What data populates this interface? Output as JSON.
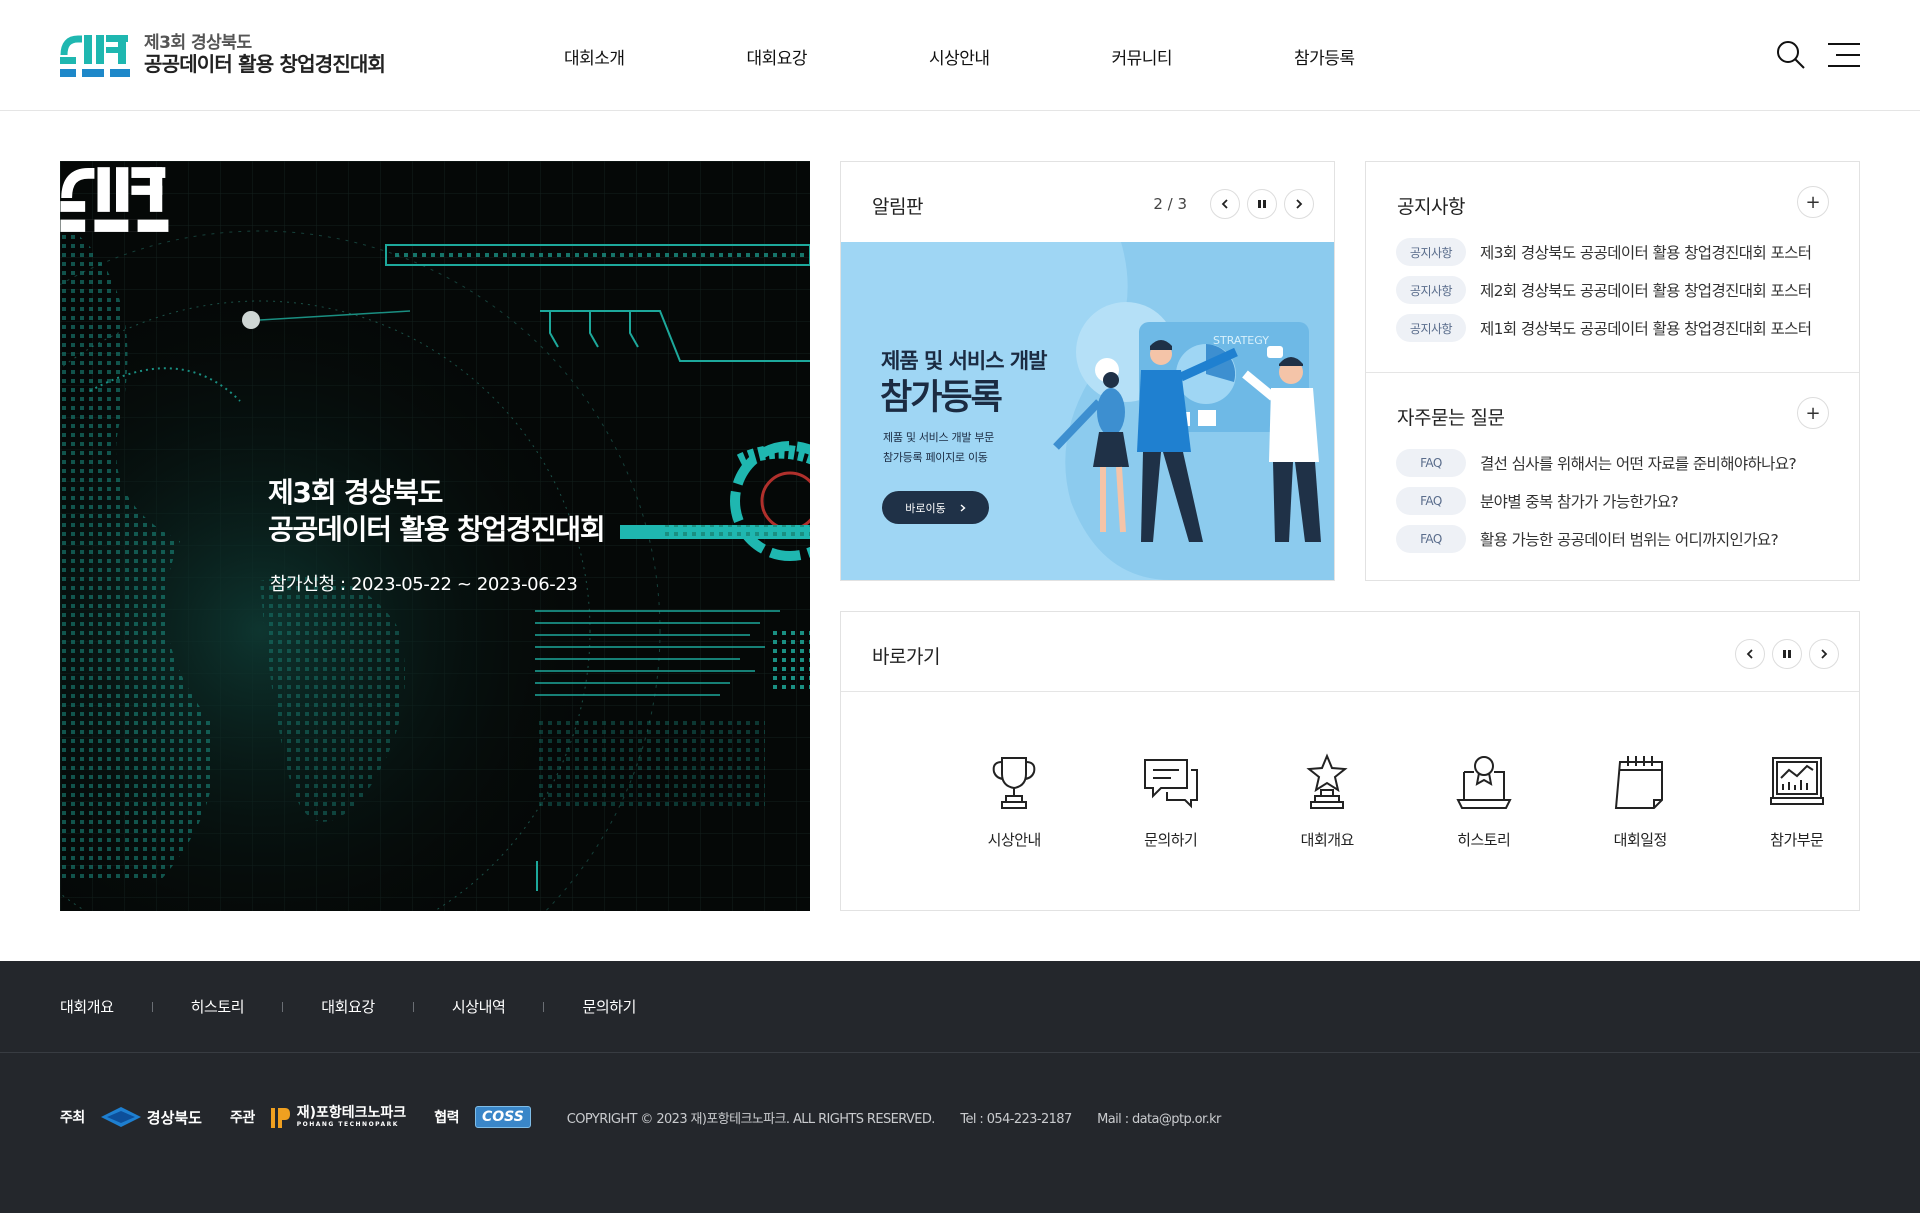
{
  "header": {
    "logo_small": "제3회 경상북도",
    "logo_big": "공공데이터 활용 창업경진대회",
    "nav": [
      "대회소개",
      "대회요강",
      "시상안내",
      "커뮤니티",
      "참가등록"
    ]
  },
  "hero": {
    "title_line1": "제3회 경상북도",
    "title_line2": "공공데이터 활용 창업경진대회",
    "date": "참가신청 : 2023-05-22 ~ 2023-06-23"
  },
  "board": {
    "title": "알림판",
    "page_current": "2",
    "page_sep": " / ",
    "page_total": "3",
    "banner": {
      "line1": "제품 및 서비스 개발",
      "line2": "참가등록",
      "desc1": "제품 및 서비스 개발 부문",
      "desc2": "참가등록 페이지로 이동",
      "button": "바로이동",
      "chart_word": "STRATEGY"
    }
  },
  "notice": {
    "title": "공지사항",
    "items": [
      {
        "tag": "공지사항",
        "text": "제3회 경상북도 공공데이터 활용 창업경진대회 포스터"
      },
      {
        "tag": "공지사항",
        "text": "제2회 경상북도 공공데이터 활용 창업경진대회 포스터"
      },
      {
        "tag": "공지사항",
        "text": "제1회 경상북도 공공데이터 활용 창업경진대회 포스터"
      }
    ]
  },
  "faq": {
    "title": "자주묻는 질문",
    "items": [
      {
        "tag": "FAQ",
        "text": "결선 심사를 위해서는 어떤 자료를 준비해야하나요?"
      },
      {
        "tag": "FAQ",
        "text": "분야별 중복 참가가 가능한가요?"
      },
      {
        "tag": "FAQ",
        "text": "활용 가능한 공공데이터 범위는 어디까지인가요?"
      }
    ]
  },
  "quick": {
    "title": "바로가기",
    "items": [
      {
        "label": "시상안내",
        "icon": "trophy-icon"
      },
      {
        "label": "문의하기",
        "icon": "chat-icon"
      },
      {
        "label": "대회개요",
        "icon": "star-award-icon"
      },
      {
        "label": "히스토리",
        "icon": "certificate-icon"
      },
      {
        "label": "대회일정",
        "icon": "calendar-icon"
      },
      {
        "label": "참가부문",
        "icon": "chart-board-icon"
      }
    ]
  },
  "footer": {
    "nav": [
      "대회개요",
      "히스토리",
      "대회요강",
      "시상내역",
      "문의하기"
    ],
    "host_label": "주최",
    "host_name": "경상북도",
    "organizer_label": "주관",
    "organizer_name": "재)포항테크노파크",
    "organizer_sub": "POHANG TECHNOPARK",
    "partner_label": "협력",
    "partner_name": "COSS",
    "copyright": "COPYRIGHT © 2023 재)포항테크노파크. ALL RIGHTS RESERVED.",
    "tel": "Tel : 054-223-2187",
    "mail": "Mail : data@ptp.or.kr"
  },
  "colors": {
    "brand_teal": "#1fb7b0",
    "brand_blue": "#1e88c9",
    "footer_bg": "#24272c",
    "banner_bg": "#9fd6f4",
    "tag_bg": "#eef1f6"
  }
}
